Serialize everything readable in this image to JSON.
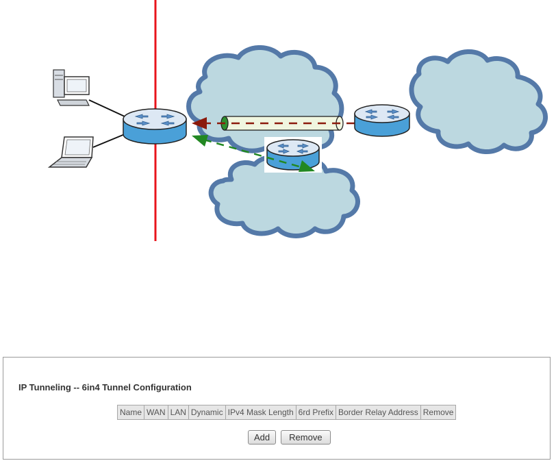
{
  "panel": {
    "title": "IP Tunneling -- 6in4 Tunnel Configuration",
    "table_headers": [
      "Name",
      "WAN",
      "LAN",
      "Dynamic",
      "IPv4 Mask Length",
      "6rd Prefix",
      "Border Relay Address",
      "Remove"
    ],
    "buttons": {
      "add": "Add",
      "remove": "Remove"
    }
  },
  "colors": {
    "boundary_line": "#e8141c",
    "cloud_fill": "#bcd8e0",
    "cloud_outline": "#5479a8",
    "router_top": "#dde8f4",
    "router_side": "#4aa0d8",
    "tunnel_fill": "#f0f6e0",
    "tunnel_arrow": "#8b1a0c",
    "relay_arrow": "#228822"
  }
}
